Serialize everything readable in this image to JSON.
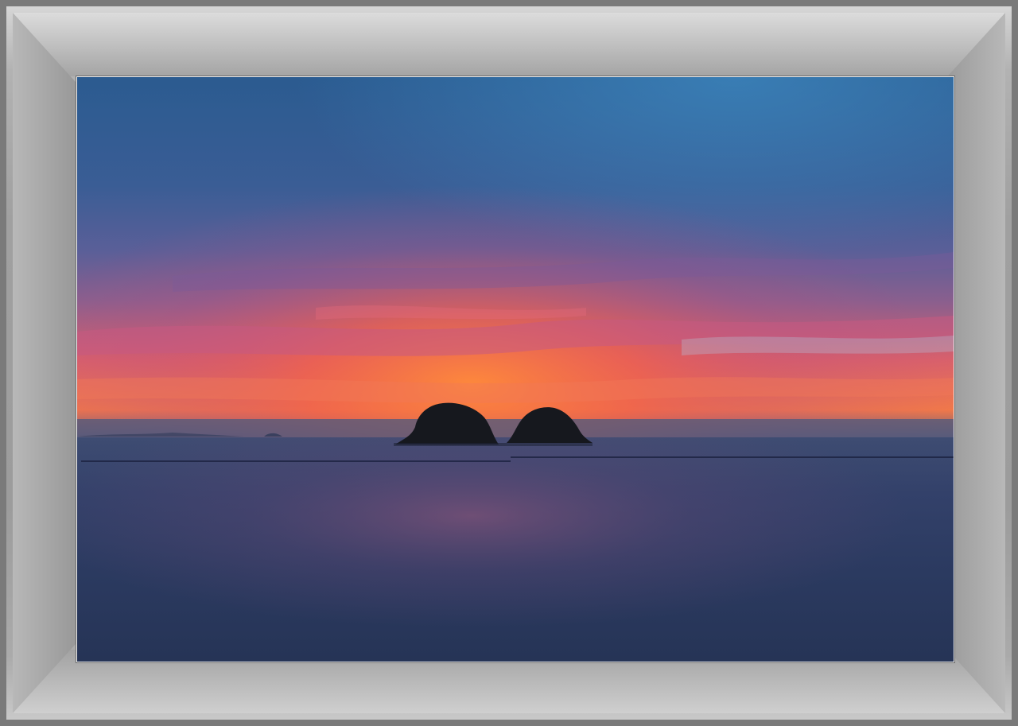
{
  "image": {
    "subject": "sunset-seascape",
    "colors": {
      "sky_top": "#2a5a8e",
      "sky_mid": "#4a5f9a",
      "glow_red": "#e8556a",
      "glow_orange": "#f07a3c",
      "sea": "#2c3a5e",
      "island": "#1a1c22",
      "frame": "#a0a0a0"
    }
  }
}
